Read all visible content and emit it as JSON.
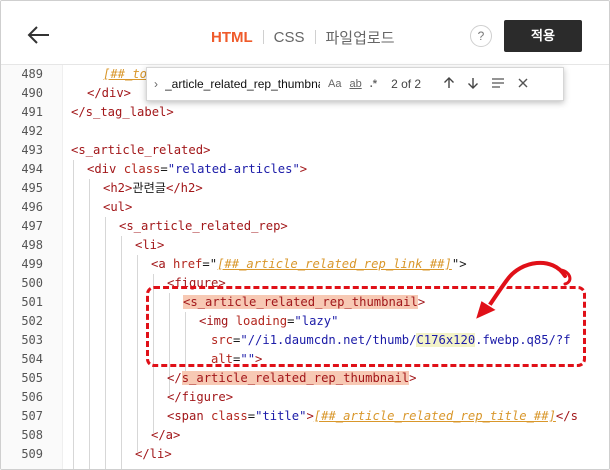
{
  "header": {
    "tabs": [
      {
        "label": "HTML",
        "active": true
      },
      {
        "label": "CSS",
        "active": false
      },
      {
        "label": "파일업로드",
        "active": false
      }
    ],
    "help_label": "?",
    "apply_label": "적용"
  },
  "find_widget": {
    "query": "_article_related_rep_thumbnail",
    "match_case": "Aa",
    "whole_word": "ab",
    "regex": ".*",
    "count": "2 of 2"
  },
  "gutter": [
    "489",
    "490",
    "491",
    "492",
    "493",
    "494",
    "495",
    "496",
    "497",
    "498",
    "499",
    "500",
    "501",
    "502",
    "503",
    "504",
    "505",
    "506",
    "507",
    "508",
    "509"
  ],
  "lines": {
    "l489_ph": "[##_to",
    "l490_close": "</div>",
    "l491_close": "</s_tag_label>",
    "l493_tag": "<s_article_related>",
    "l494_open": "<div ",
    "l494_attr": "class",
    "l494_eq": "=",
    "l494_val": "\"related-articles\"",
    "l494_end": ">",
    "l495_open": "<h2>",
    "l495_text": "관련글",
    "l495_close": "</h2>",
    "l496_tag": "<ul>",
    "l497_tag": "<s_article_related_rep>",
    "l498_tag": "<li>",
    "l499_open": "<a ",
    "l499_attr": "href",
    "l499_eq": "=\"",
    "l499_ph": "[##_article_related_rep_link_##]",
    "l499_end": "\">",
    "l500_tag": "<figure>",
    "l501_open": "<",
    "l501_hl": "s_article_related_rep_thumbnail",
    "l501_end": ">",
    "l502_open": "<img ",
    "l502_attr": "loading",
    "l502_eq": "=",
    "l502_val": "\"lazy\"",
    "l503_attr": "src",
    "l503_eq": "=",
    "l503_val1": "\"//i1.daumcdn.net/thumb/",
    "l503_hl": "C176x120",
    "l503_val2": ".fwebp.q85/?f",
    "l504_attr": "alt",
    "l504_eq": "=",
    "l504_val": "\"\"",
    "l504_end": ">",
    "l505_open": "</",
    "l505_hl": "s_article_related_rep_thumbnail",
    "l505_end": ">",
    "l506_tag": "</figure>",
    "l507_open": "<span ",
    "l507_attr": "class",
    "l507_eq": "=",
    "l507_val": "\"title\"",
    "l507_gt": ">",
    "l507_ph": "[##_article_related_rep_title_##]",
    "l507_end": "</s",
    "l508_tag": "</a>",
    "l509_tag": "</li>"
  },
  "colors": {
    "accent": "#ef5b2b",
    "apply_bg": "#2b2b2b",
    "annotation": "#e01018",
    "highlight": "#f7c9b4"
  },
  "icons": [
    "back-arrow-icon",
    "chevron-right-icon",
    "arrow-up-icon",
    "arrow-down-icon",
    "menu-icon",
    "close-icon",
    "curved-arrow-icon"
  ]
}
